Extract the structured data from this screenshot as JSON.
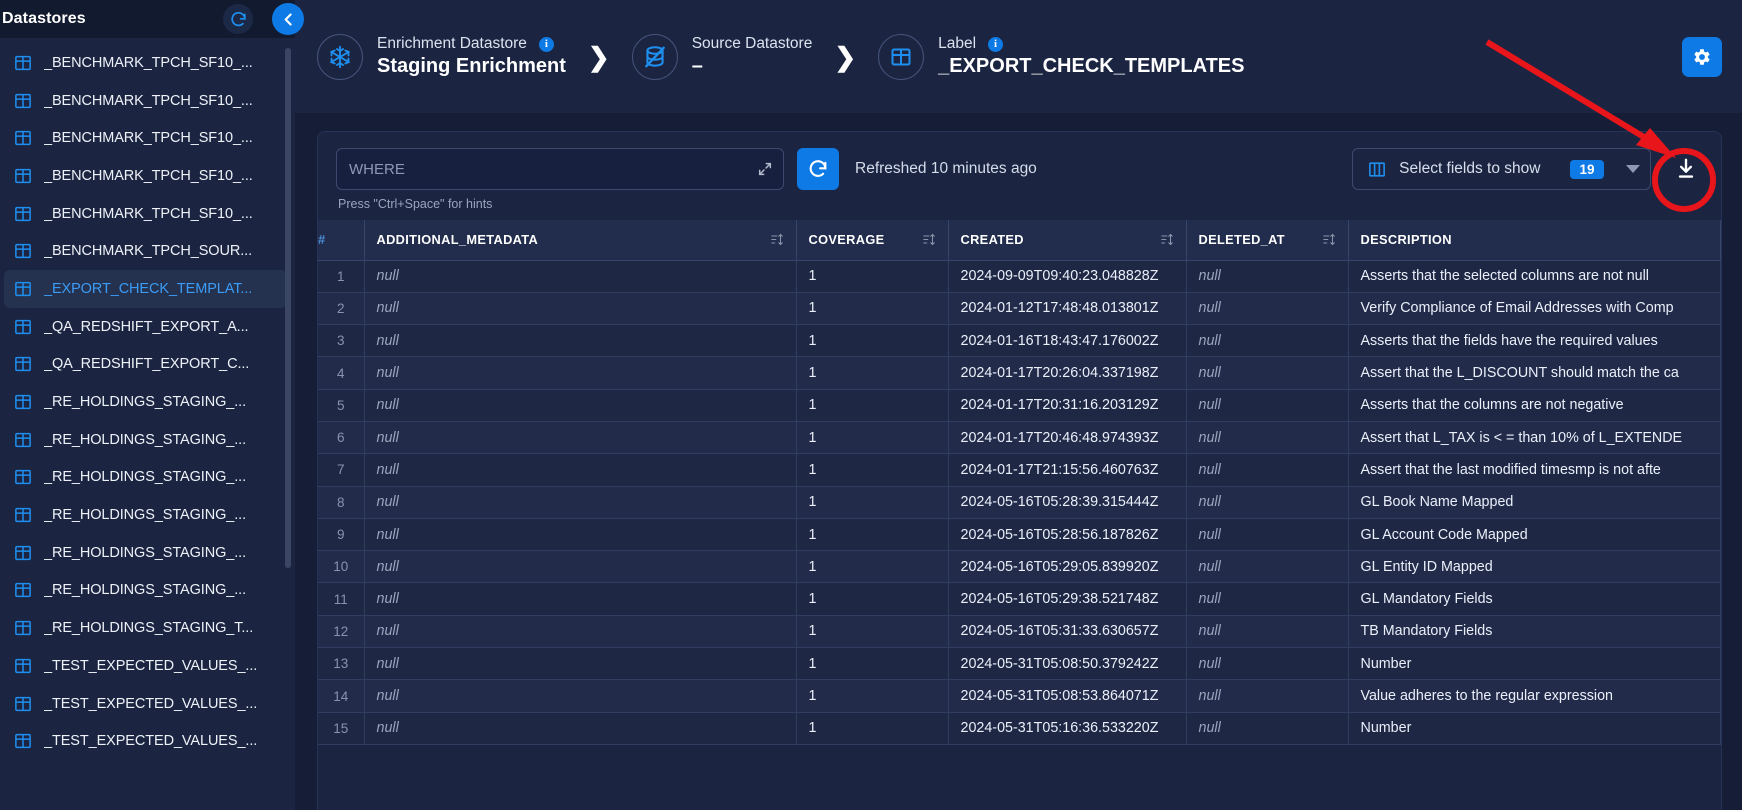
{
  "sidebar": {
    "title": "Datastores",
    "refresh_icon": "refresh-icon",
    "collapse_icon": "chevron-left-icon",
    "items": [
      {
        "label": "_BENCHMARK_TPCH_SF10_...",
        "selected": false
      },
      {
        "label": "_BENCHMARK_TPCH_SF10_...",
        "selected": false
      },
      {
        "label": "_BENCHMARK_TPCH_SF10_...",
        "selected": false
      },
      {
        "label": "_BENCHMARK_TPCH_SF10_...",
        "selected": false
      },
      {
        "label": "_BENCHMARK_TPCH_SF10_...",
        "selected": false
      },
      {
        "label": "_BENCHMARK_TPCH_SOUR...",
        "selected": false
      },
      {
        "label": "_EXPORT_CHECK_TEMPLAT...",
        "selected": true
      },
      {
        "label": "_QA_REDSHIFT_EXPORT_A...",
        "selected": false
      },
      {
        "label": "_QA_REDSHIFT_EXPORT_C...",
        "selected": false
      },
      {
        "label": "_RE_HOLDINGS_STAGING_...",
        "selected": false
      },
      {
        "label": "_RE_HOLDINGS_STAGING_...",
        "selected": false
      },
      {
        "label": "_RE_HOLDINGS_STAGING_...",
        "selected": false
      },
      {
        "label": "_RE_HOLDINGS_STAGING_...",
        "selected": false
      },
      {
        "label": "_RE_HOLDINGS_STAGING_...",
        "selected": false
      },
      {
        "label": "_RE_HOLDINGS_STAGING_...",
        "selected": false
      },
      {
        "label": "_RE_HOLDINGS_STAGING_T...",
        "selected": false
      },
      {
        "label": "_TEST_EXPECTED_VALUES_...",
        "selected": false
      },
      {
        "label": "_TEST_EXPECTED_VALUES_...",
        "selected": false
      },
      {
        "label": "_TEST_EXPECTED_VALUES_...",
        "selected": false
      }
    ]
  },
  "breadcrumb": {
    "items": [
      {
        "kind": "Enrichment Datastore",
        "value": "Staging Enrichment",
        "icon": "snowflake-icon",
        "info": true
      },
      {
        "kind": "Source Datastore",
        "value": "–",
        "icon": "database-off-icon",
        "info": false
      },
      {
        "kind": "Label",
        "value": "_EXPORT_CHECK_TEMPLATES",
        "icon": "table-icon",
        "info": true
      }
    ],
    "separator": "❯",
    "settings_icon": "gear-icon"
  },
  "toolbar": {
    "where_placeholder": "WHERE",
    "where_value": "",
    "expand_icon": "expand-icon",
    "hint": "Press \"Ctrl+Space\" for hints",
    "refresh_icon": "refresh-icon",
    "refreshed_label": "Refreshed 10 minutes ago",
    "fields_icon": "columns-icon",
    "fields_label": "Select fields to show",
    "fields_count": "19",
    "caret_icon": "chevron-down-icon",
    "download_icon": "download-icon",
    "download_highlight_color": "#e8151a"
  },
  "table": {
    "columns": [
      {
        "label": "#",
        "sortable": false,
        "key": "idx"
      },
      {
        "label": "ADDITIONAL_METADATA",
        "sortable": true,
        "key": "additional_metadata"
      },
      {
        "label": "COVERAGE",
        "sortable": true,
        "key": "coverage"
      },
      {
        "label": "CREATED",
        "sortable": true,
        "key": "created"
      },
      {
        "label": "DELETED_AT",
        "sortable": true,
        "key": "deleted_at"
      },
      {
        "label": "DESCRIPTION",
        "sortable": false,
        "key": "description"
      }
    ],
    "rows": [
      {
        "idx": "1",
        "additional_metadata": "null",
        "coverage": "1",
        "created": "2024-09-09T09:40:23.048828Z",
        "deleted_at": "null",
        "description": "Asserts that the selected columns are not null"
      },
      {
        "idx": "2",
        "additional_metadata": "null",
        "coverage": "1",
        "created": "2024-01-12T17:48:48.013801Z",
        "deleted_at": "null",
        "description": "Verify Compliance of Email Addresses with Comp"
      },
      {
        "idx": "3",
        "additional_metadata": "null",
        "coverage": "1",
        "created": "2024-01-16T18:43:47.176002Z",
        "deleted_at": "null",
        "description": "Asserts that the fields have the required values"
      },
      {
        "idx": "4",
        "additional_metadata": "null",
        "coverage": "1",
        "created": "2024-01-17T20:26:04.337198Z",
        "deleted_at": "null",
        "description": "Assert that the L_DISCOUNT should match the ca"
      },
      {
        "idx": "5",
        "additional_metadata": "null",
        "coverage": "1",
        "created": "2024-01-17T20:31:16.203129Z",
        "deleted_at": "null",
        "description": "Asserts that the columns are not negative"
      },
      {
        "idx": "6",
        "additional_metadata": "null",
        "coverage": "1",
        "created": "2024-01-17T20:46:48.974393Z",
        "deleted_at": "null",
        "description": "Assert that L_TAX is < = than 10% of L_EXTENDE"
      },
      {
        "idx": "7",
        "additional_metadata": "null",
        "coverage": "1",
        "created": "2024-01-17T21:15:56.460763Z",
        "deleted_at": "null",
        "description": "Assert that the last modified timesmp is not afte"
      },
      {
        "idx": "8",
        "additional_metadata": "null",
        "coverage": "1",
        "created": "2024-05-16T05:28:39.315444Z",
        "deleted_at": "null",
        "description": "GL Book Name Mapped"
      },
      {
        "idx": "9",
        "additional_metadata": "null",
        "coverage": "1",
        "created": "2024-05-16T05:28:56.187826Z",
        "deleted_at": "null",
        "description": "GL Account Code Mapped"
      },
      {
        "idx": "10",
        "additional_metadata": "null",
        "coverage": "1",
        "created": "2024-05-16T05:29:05.839920Z",
        "deleted_at": "null",
        "description": "GL Entity ID Mapped"
      },
      {
        "idx": "11",
        "additional_metadata": "null",
        "coverage": "1",
        "created": "2024-05-16T05:29:38.521748Z",
        "deleted_at": "null",
        "description": "GL Mandatory Fields"
      },
      {
        "idx": "12",
        "additional_metadata": "null",
        "coverage": "1",
        "created": "2024-05-16T05:31:33.630657Z",
        "deleted_at": "null",
        "description": "TB Mandatory Fields"
      },
      {
        "idx": "13",
        "additional_metadata": "null",
        "coverage": "1",
        "created": "2024-05-31T05:08:50.379242Z",
        "deleted_at": "null",
        "description": "Number"
      },
      {
        "idx": "14",
        "additional_metadata": "null",
        "coverage": "1",
        "created": "2024-05-31T05:08:53.864071Z",
        "deleted_at": "null",
        "description": "Value adheres to the regular expression"
      },
      {
        "idx": "15",
        "additional_metadata": "null",
        "coverage": "1",
        "created": "2024-05-31T05:16:36.533220Z",
        "deleted_at": "null",
        "description": "Number"
      }
    ]
  },
  "colors": {
    "accent": "#0d7ae5",
    "panel_bg": "#1b2542",
    "page_bg": "#151e36",
    "header_bg": "#222d4d",
    "annotation": "#e8151a"
  }
}
